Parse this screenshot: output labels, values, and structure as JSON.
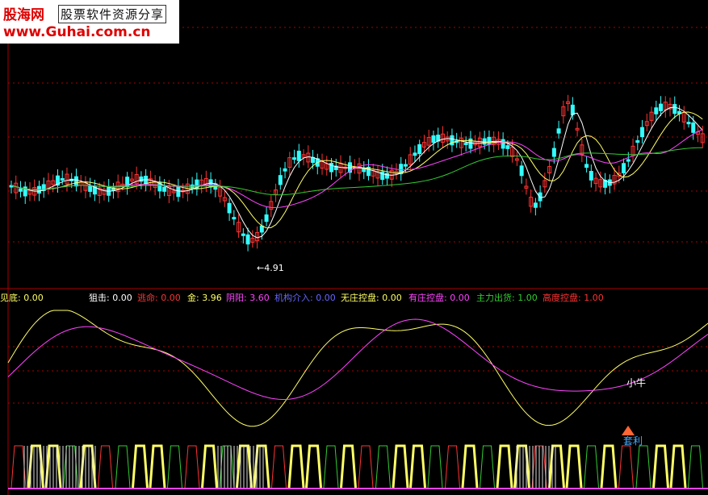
{
  "watermark": {
    "site_name": "股海网",
    "subtitle": "股票软件资源分享",
    "url": "www.Guhai.com.cn"
  },
  "price_panel": {
    "low_label": "←4.91"
  },
  "indicator_legend": [
    {
      "label": "见底: 0.00",
      "color": "#ffff66"
    },
    {
      "label": "狙击: 0.00",
      "color": "#ffffff"
    },
    {
      "label": "逃命: 0.00",
      "color": "#ff3333"
    },
    {
      "label": "金: 3.96",
      "color": "#ffff66"
    },
    {
      "label": "阴阳: 3.60",
      "color": "#ff44ff"
    },
    {
      "label": "机构介入: 0.00",
      "color": "#6666ff"
    },
    {
      "label": "无庄控盘: 0.00",
      "color": "#ffff66"
    },
    {
      "label": "有庄控盘: 0.00",
      "color": "#ff44ff"
    },
    {
      "label": "主力出货: 1.00",
      "color": "#33cc33"
    },
    {
      "label": "高度控盘: 1.00",
      "color": "#ff3333"
    }
  ],
  "annotations": {
    "ox_label": "小牛",
    "arbitrage_label": "套利"
  },
  "colors": {
    "up_candle": "#ff3333",
    "down_candle": "#33ffff",
    "ma_short": "#ffffff",
    "ma_mid": "#ffff66",
    "ma_long": "#ff44ff",
    "ma_longest": "#33cc33",
    "grid": "#aa0000"
  }
}
